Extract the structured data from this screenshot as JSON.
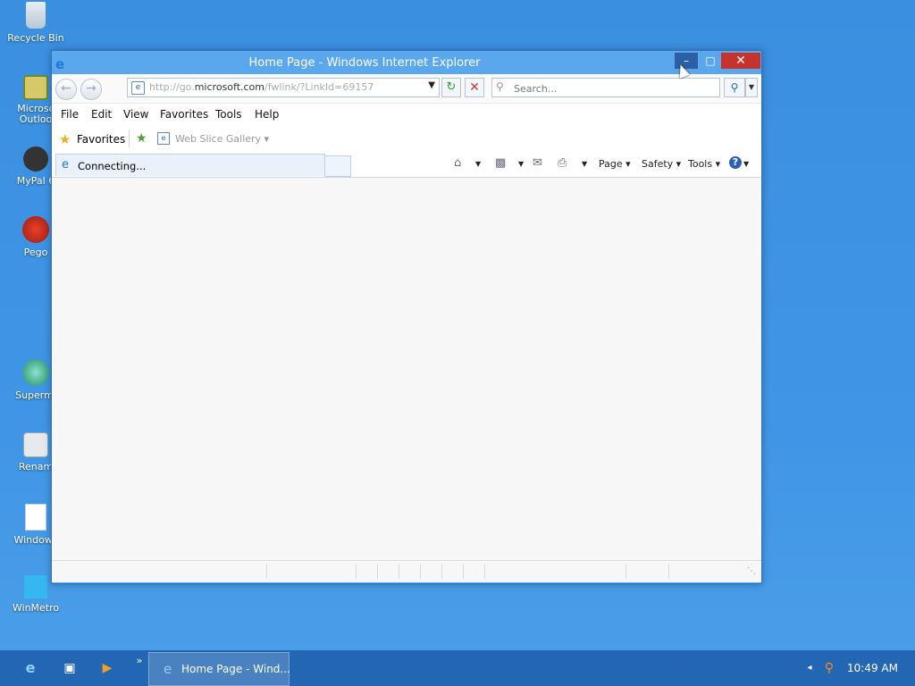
{
  "desktop": {
    "icons": [
      {
        "label": "Recycle Bin",
        "icon": "recycle-bin-icon"
      },
      {
        "label": "Microsc Outloo",
        "icon": "outlook-icon"
      },
      {
        "label": "MyPal 6",
        "icon": "mypal-icon"
      },
      {
        "label": "Pego",
        "icon": "pego-icon"
      },
      {
        "label": "Supermi",
        "icon": "supermium-icon"
      },
      {
        "label": "Renam",
        "icon": "rename-icon"
      },
      {
        "label": "Windows",
        "icon": "file-icon"
      },
      {
        "label": "WinMetro",
        "icon": "winmetro-icon"
      }
    ]
  },
  "window": {
    "title": "Home Page - Windows Internet Explorer",
    "address": {
      "prefix": "http://go.",
      "domain": "microsoft.com",
      "suffix": "/fwlink/?LinkId=69157"
    },
    "search_placeholder": "Search...",
    "menu": [
      "File",
      "Edit",
      "View",
      "Favorites",
      "Tools",
      "Help"
    ],
    "favorites_label": "Favorites",
    "web_slice_gallery": "Web Slice Gallery",
    "tab_label": "Connecting...",
    "commands": {
      "page": "Page",
      "safety": "Safety",
      "tools": "Tools"
    }
  },
  "taskbar": {
    "task_label": "Home Page - Wind...",
    "clock": "10:49 AM"
  },
  "colors": {
    "accent": "#3f95e6",
    "close": "#c8322c"
  }
}
